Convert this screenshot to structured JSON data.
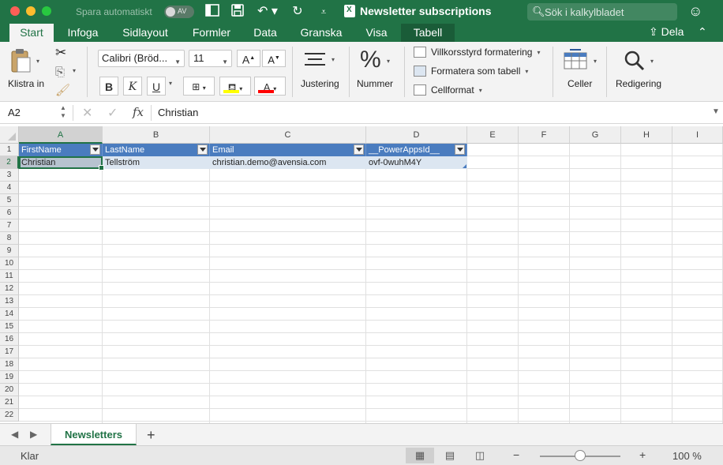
{
  "titlebar": {
    "autosave_label": "Spara automatiskt",
    "autosave_state": "AV",
    "doc_title": "Newsletter subscriptions",
    "search_placeholder": "Sök i kalkylbladet"
  },
  "tabs": [
    "Start",
    "Infoga",
    "Sidlayout",
    "Formler",
    "Data",
    "Granska",
    "Visa",
    "Tabell"
  ],
  "active_tab": "Start",
  "share_label": "Dela",
  "ribbon": {
    "paste_label": "Klistra in",
    "font_name": "Calibri (Bröd...",
    "font_size": "11",
    "bold": "B",
    "italic": "K",
    "underline": "U",
    "alignment_label": "Justering",
    "number_label": "Nummer",
    "conditional_formatting": "Villkorsstyrd formatering",
    "format_as_table": "Formatera som tabell",
    "cell_styles": "Cellformat",
    "cells_label": "Celler",
    "editing_label": "Redigering",
    "accent": "#217346",
    "highlight_color": "#ffff00",
    "font_color": "#ff0000"
  },
  "formula_bar": {
    "name_box": "A2",
    "fx": "fx",
    "value": "Christian"
  },
  "grid": {
    "columns": [
      "A",
      "B",
      "C",
      "D",
      "E",
      "F",
      "G",
      "H",
      "I"
    ],
    "rows": [
      "1",
      "2",
      "3",
      "4",
      "5",
      "6",
      "7",
      "8",
      "9",
      "10",
      "11",
      "12",
      "13",
      "14",
      "15",
      "16",
      "17",
      "18",
      "19",
      "20",
      "21",
      "22"
    ],
    "table_headers": [
      "FirstName",
      "LastName",
      "Email",
      "__PowerAppsId__"
    ],
    "table_row": [
      "Christian",
      "Tellström",
      "christian.demo@avensia.com",
      "ovf-0wuhM4Y"
    ],
    "table_header_color": "#4a7cbf",
    "table_row_color": "#dce6f1"
  },
  "sheets": {
    "active": "Newsletters"
  },
  "statusbar": {
    "status": "Klar",
    "zoom": "100 %",
    "zoom_fraction": 0.5
  }
}
